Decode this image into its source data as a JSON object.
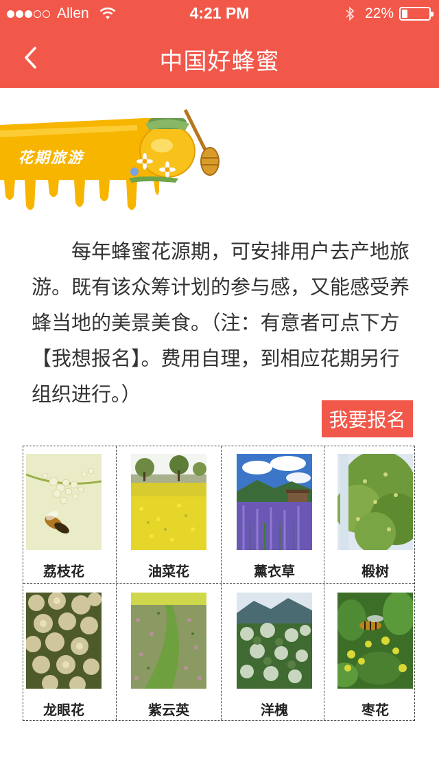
{
  "status_bar": {
    "carrier": "Allen",
    "time": "4:21 PM",
    "battery": "22%",
    "battery_level": 0.22,
    "signal_bars_filled": 3,
    "signal_bars_total": 5
  },
  "nav": {
    "title": "中国好蜂蜜",
    "back_icon": "chevron-left-icon"
  },
  "banner": {
    "label": "花期旅游",
    "icon": "honey-jar-icon"
  },
  "intro_text": "每年蜂蜜花源期，可安排用户去产地旅游。既有该众筹计划的参与感，又能感受养蜂当地的美景美食。（注：有意者可点下方【我想报名】。费用自理，到相应花期另行组织进行。）",
  "signup_button": "我要报名",
  "flowers": [
    {
      "name": "荔枝花",
      "icon": "lychee-flower-photo"
    },
    {
      "name": "油菜花",
      "icon": "rapeseed-flower-photo"
    },
    {
      "name": "薰衣草",
      "icon": "lavender-photo"
    },
    {
      "name": "椴树",
      "icon": "linden-tree-photo"
    },
    {
      "name": "龙眼花",
      "icon": "longan-flower-photo"
    },
    {
      "name": "紫云英",
      "icon": "milk-vetch-photo"
    },
    {
      "name": "洋槐",
      "icon": "black-locust-photo"
    },
    {
      "name": "枣花",
      "icon": "jujube-flower-photo"
    }
  ],
  "colors": {
    "accent": "#f2584a",
    "honey": "#f5b800",
    "text": "#333333"
  }
}
